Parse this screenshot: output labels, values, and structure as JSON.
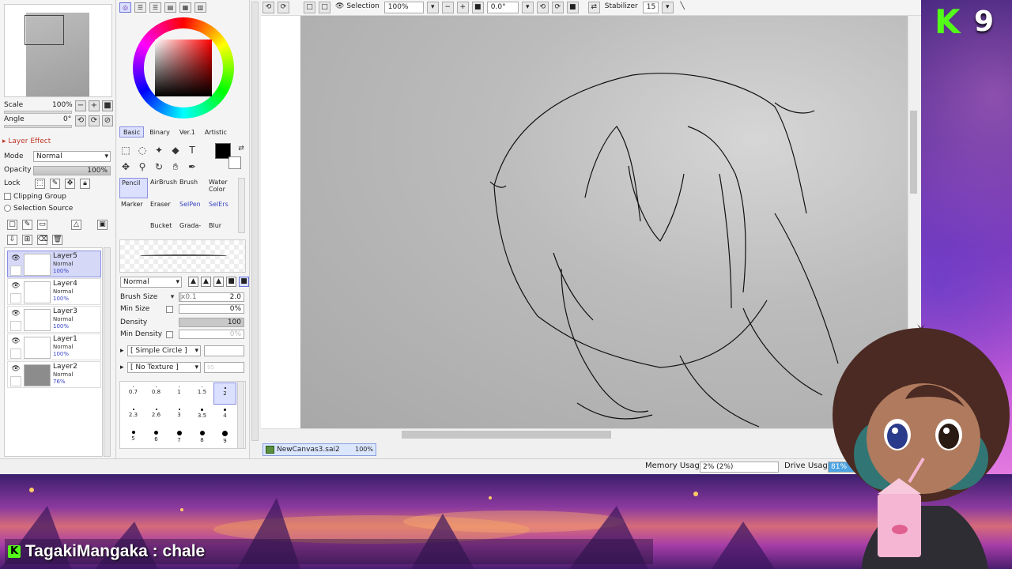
{
  "left_panel": {
    "scale_label": "Scale",
    "scale_value": "100%",
    "angle_label": "Angle",
    "angle_value": "0°",
    "layer_effect": "Layer Effect",
    "mode_label": "Mode",
    "mode_value": "Normal",
    "opacity_label": "Opacity",
    "opacity_value": "100%",
    "lock_label": "Lock",
    "clipping_group": "Clipping Group",
    "selection_source": "Selection Source",
    "layers": [
      {
        "name": "Layer5",
        "mode": "Normal",
        "opacity": "100%",
        "active": true
      },
      {
        "name": "Layer4",
        "mode": "Normal",
        "opacity": "100%",
        "active": false
      },
      {
        "name": "Layer3",
        "mode": "Normal",
        "opacity": "100%",
        "active": false
      },
      {
        "name": "Layer1",
        "mode": "Normal",
        "opacity": "100%",
        "active": false
      },
      {
        "name": "Layer2",
        "mode": "Normal",
        "opacity": "76%",
        "active": false
      }
    ]
  },
  "tool_panel": {
    "tabs": [
      "Basic",
      "Binary",
      "Ver.1",
      "Artistic"
    ],
    "brushes": [
      {
        "label": "Pencil",
        "active": true,
        "blue": false
      },
      {
        "label": "AirBrush",
        "active": false,
        "blue": false
      },
      {
        "label": "Brush",
        "active": false,
        "blue": false
      },
      {
        "label": "Water Color",
        "active": false,
        "blue": false
      },
      {
        "label": "Marker",
        "active": false,
        "blue": false
      },
      {
        "label": "Eraser",
        "active": false,
        "blue": false
      },
      {
        "label": "SelPen",
        "active": false,
        "blue": true
      },
      {
        "label": "SelErs",
        "active": false,
        "blue": true
      },
      {
        "label": "Bucket",
        "active": false,
        "blue": false
      },
      {
        "label": "Grada-",
        "active": false,
        "blue": false
      },
      {
        "label": "Blur",
        "active": false,
        "blue": false
      }
    ],
    "blend_mode": "Normal",
    "brush_size_label": "Brush Size",
    "brush_size_mult": "x0.1",
    "brush_size_value": "2.0",
    "min_size_label": "Min Size",
    "min_size_value": "0%",
    "density_label": "Density",
    "density_value": "100",
    "min_density_label": "Min Density",
    "min_density_value": "0%",
    "shape": "[ Simple Circle ]",
    "texture": "[ No Texture ]",
    "texture_strength": "95",
    "sizes": [
      "0.7",
      "0.8",
      "1",
      "1.5",
      "2",
      "2.3",
      "2.6",
      "3",
      "3.5",
      "4",
      "5",
      "6",
      "7",
      "8",
      "9"
    ],
    "selected_size": "2"
  },
  "toolbar": {
    "selection_label": "Selection",
    "zoom": "100%",
    "rotation": "0.0°",
    "stabilizer_label": "Stabilizer",
    "stabilizer_value": "15"
  },
  "file_tab": {
    "name": "NewCanvas3.sai2",
    "zoom": "100%"
  },
  "status": {
    "memory_label": "Memory Usage",
    "memory_value": "2% (2%)",
    "drive_label": "Drive Usage",
    "drive_value": "81%"
  },
  "overlay": {
    "kick_logo": "K",
    "viewer_count": "9",
    "chat_user": "TagakiMangaka",
    "chat_sep": " : ",
    "chat_text": "chale"
  },
  "colors": {
    "accent": "#8a8fe0",
    "kick_green": "#53fc18",
    "brush_blue": "#3a46c2"
  }
}
